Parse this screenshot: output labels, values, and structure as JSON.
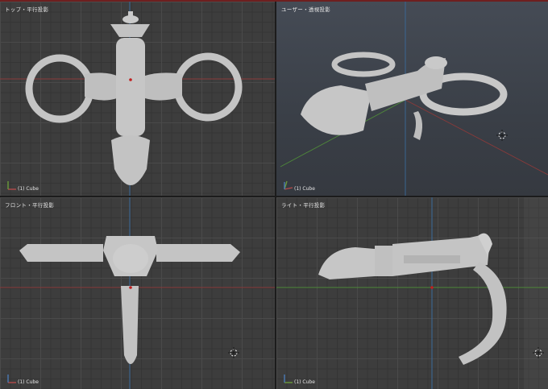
{
  "viewports": {
    "top": {
      "title": "トップ・平行投影",
      "object": "(1) Cube"
    },
    "user": {
      "title": "ユーザー・透視投影",
      "object": "(1) Cube"
    },
    "front": {
      "title": "フロント・平行投影",
      "object": "(1) Cube"
    },
    "right": {
      "title": "ライト・平行投影",
      "object": "(1) Cube"
    }
  },
  "colors": {
    "x_axis": "#b54a4a",
    "y_axis": "#6a9a3a",
    "z_axis": "#4a7ab5",
    "model": "#c8c8c8",
    "window_accent": "#6e1f1f"
  },
  "icons": [
    "axis-gizmo-icon",
    "3d-cursor-icon"
  ]
}
